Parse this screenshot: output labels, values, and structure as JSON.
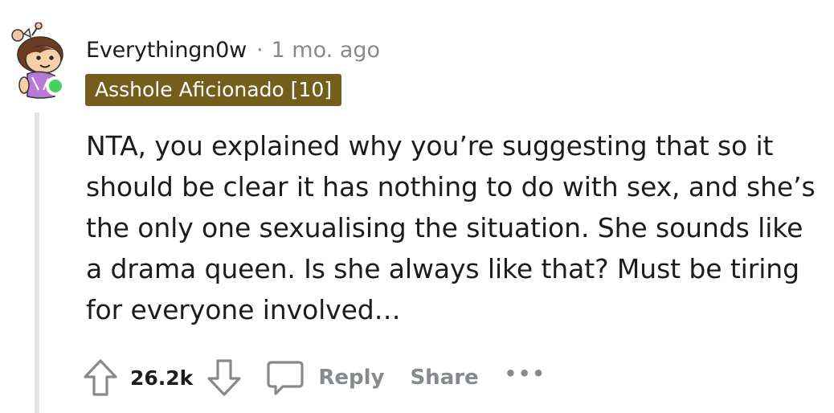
{
  "comment": {
    "username": "Everythingn0w",
    "separator": "·",
    "timestamp": "1 mo. ago",
    "flair": "Asshole Aficionado [10]",
    "flair_color": "#745e1c",
    "online_color": "#46d160",
    "body": "NTA, you explained why you’re suggesting that so it should be clear it has nothing to do with sex, and she’s the only one sexualising the situation. She sounds like a drama queen. Is she always like that? Must be tiring for everyone involved…",
    "avatar_icon": "snoo-avatar-icon"
  },
  "actions": {
    "upvote_icon": "upvote-arrow-icon",
    "vote_count": "26.2k",
    "downvote_icon": "downvote-arrow-icon",
    "reply_icon": "comment-bubble-icon",
    "reply_label": "Reply",
    "share_label": "Share",
    "more_label": "•••"
  }
}
